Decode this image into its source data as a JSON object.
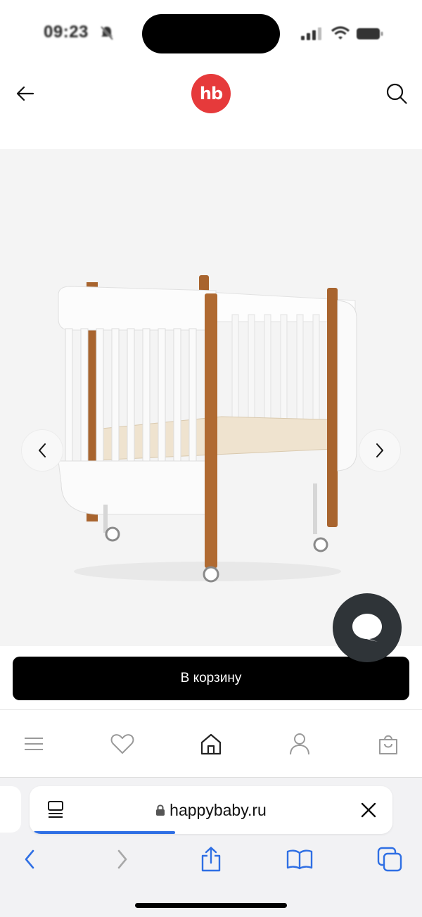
{
  "status_bar": {
    "time": "09:23"
  },
  "header": {
    "logo_text": "hb",
    "brand_color": "#e63a3b"
  },
  "gallery": {
    "image_name": "crib-product-image"
  },
  "cart": {
    "button_label": "В корзину"
  },
  "bottom_nav": {
    "items": [
      "menu-icon",
      "heart-icon",
      "home-icon",
      "profile-icon",
      "bag-icon"
    ]
  },
  "browser": {
    "url": "happybaby.ru",
    "load_progress": 0.39,
    "accent_color": "#2f6fe4"
  }
}
